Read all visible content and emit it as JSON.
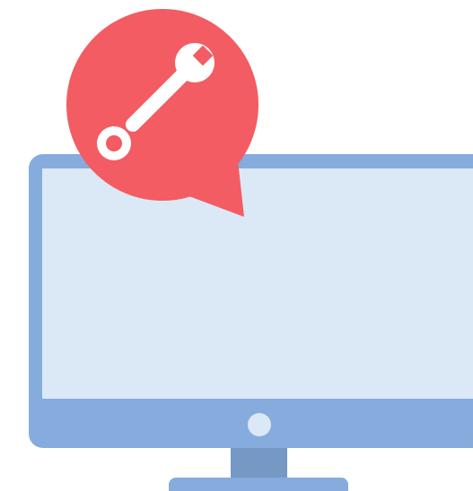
{
  "illustration": {
    "subject": "computer-maintenance",
    "icons": [
      "monitor-icon",
      "wrench-icon",
      "speech-bubble-icon"
    ],
    "colors": {
      "background": "#ffffff",
      "monitor_frame": "#86acdd",
      "monitor_screen": "#dbe8f6",
      "monitor_stand_neck": "#7598c5",
      "monitor_base": "#86acdd",
      "power_button": "#dbe8f6",
      "bubble": "#f35c62",
      "wrench": "#ffffff"
    }
  }
}
